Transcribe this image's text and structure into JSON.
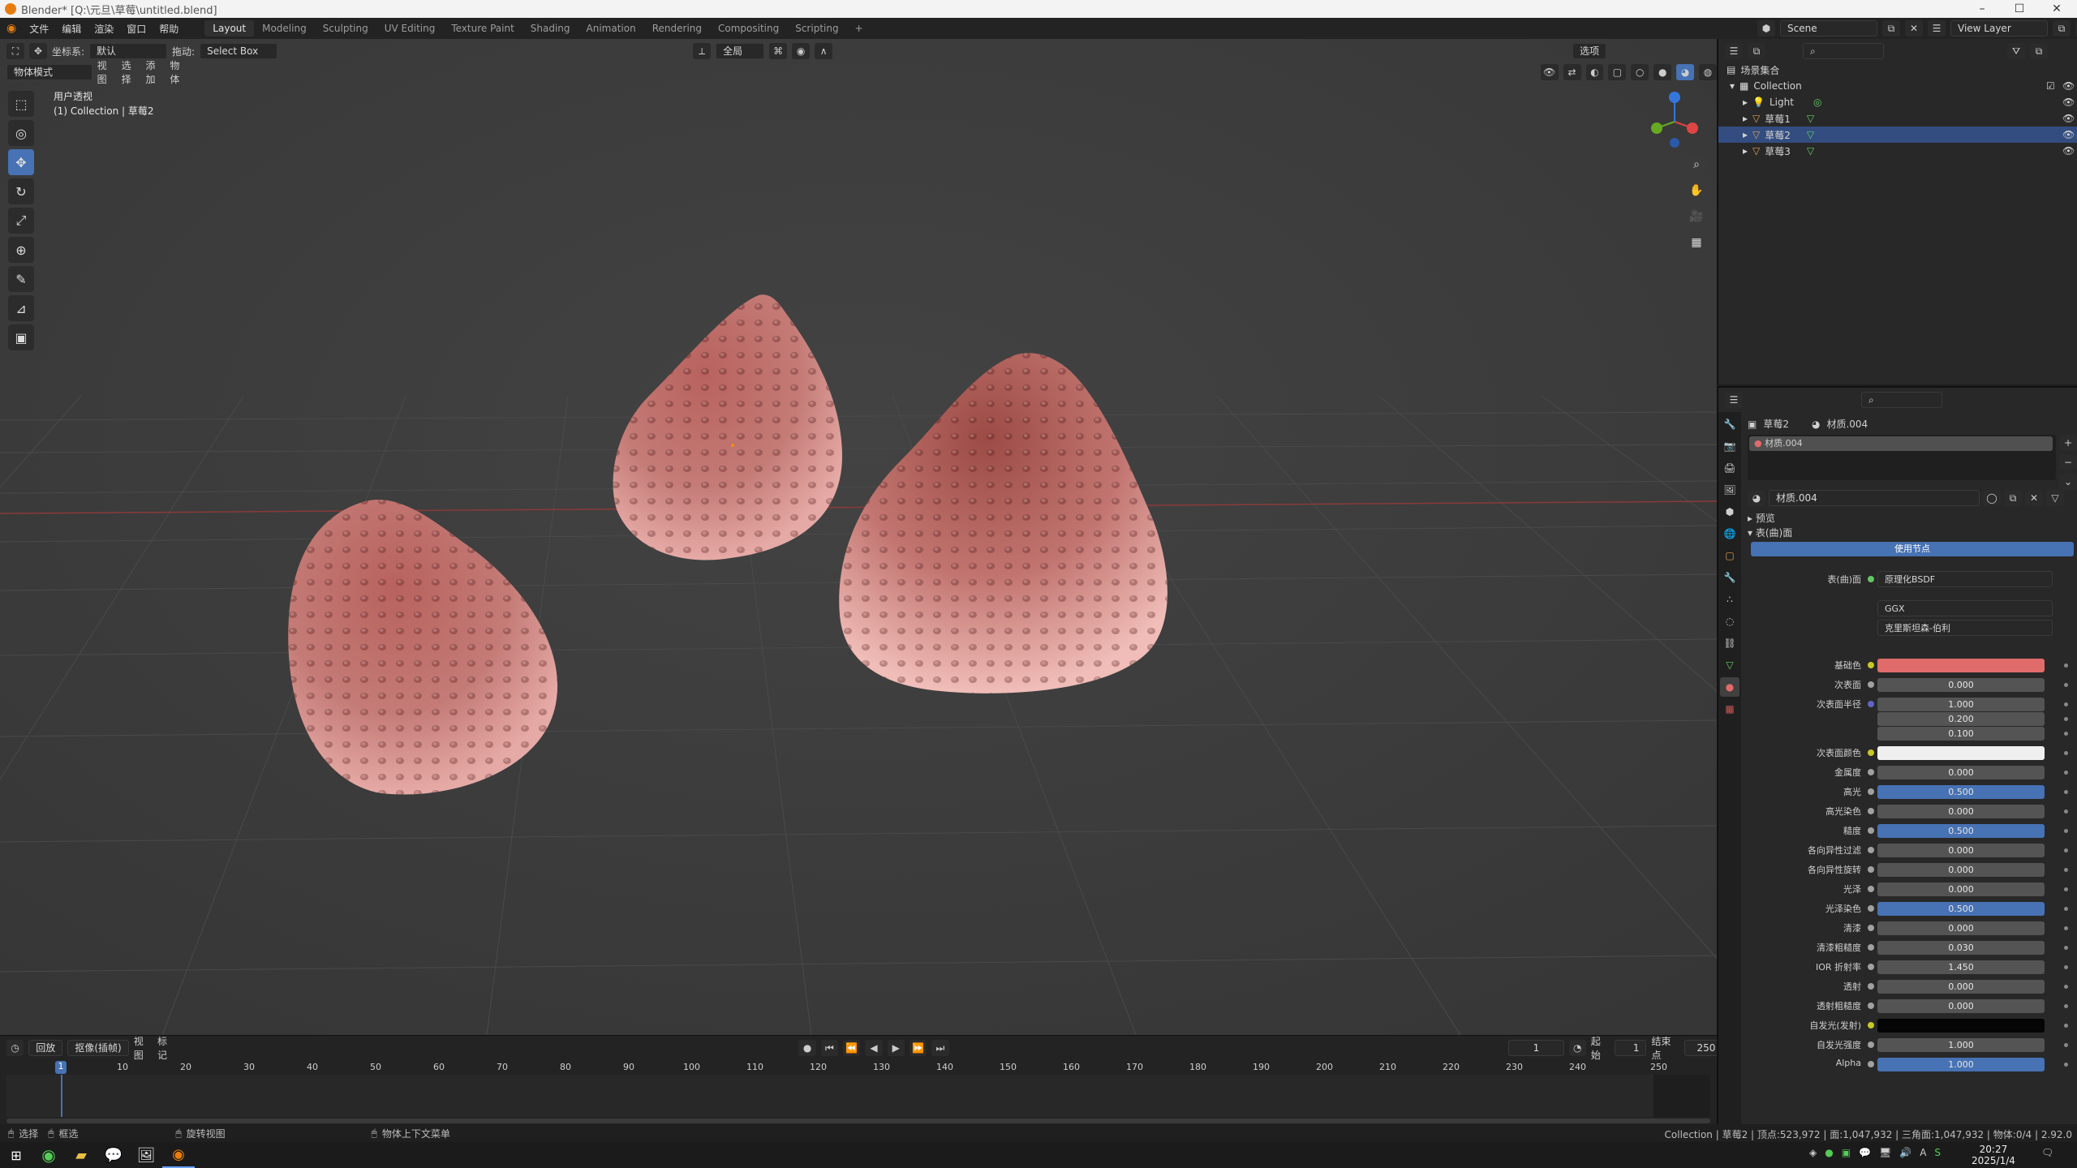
{
  "window": {
    "title": "Blender* [Q:\\元旦\\草莓\\untitled.blend]"
  },
  "menu": [
    "文件",
    "编辑",
    "渲染",
    "窗口",
    "帮助"
  ],
  "workspaces": [
    "Layout",
    "Modeling",
    "Sculpting",
    "UV Editing",
    "Texture Paint",
    "Shading",
    "Animation",
    "Rendering",
    "Compositing",
    "Scripting"
  ],
  "active_workspace": "Layout",
  "scene_selector": {
    "scene": "Scene",
    "view_layer": "View Layer"
  },
  "viewport_header": {
    "orientation_label": "坐标系:",
    "orientation_value": "默认",
    "drag_label": "拖动:",
    "drag_value": "Select Box",
    "pivot_value": "全局",
    "options_label": "选项",
    "mode": "物体模式",
    "view_menu": [
      "视图",
      "选择",
      "添加",
      "物体"
    ]
  },
  "viewport_info": {
    "line1": "用户透视",
    "line2": "(1) Collection | 草莓2"
  },
  "tools": [
    {
      "name": "select-box-icon",
      "glyph": "⬚"
    },
    {
      "name": "cursor-icon",
      "glyph": "◎"
    },
    {
      "name": "move-icon",
      "glyph": "✥"
    },
    {
      "name": "rotate-icon",
      "glyph": "↻"
    },
    {
      "name": "scale-icon",
      "glyph": "⤢"
    },
    {
      "name": "transform-icon",
      "glyph": "⊕"
    },
    {
      "name": "annotate-icon",
      "glyph": "✎"
    },
    {
      "name": "measure-icon",
      "glyph": "📐"
    },
    {
      "name": "add-cube-icon",
      "glyph": "▣"
    }
  ],
  "outliner": {
    "root": "场景集合",
    "collection": "Collection",
    "items": [
      "Light",
      "草莓1",
      "草莓2",
      "草莓3"
    ]
  },
  "properties": {
    "object_name": "草莓2",
    "material_name": "材质.004",
    "slot_name": "材质.004",
    "section_preview": "预览",
    "section_surface": "表(曲)面",
    "use_nodes": "使用节点",
    "surface_label": "表(曲)面",
    "surface_value": "原理化BSDF",
    "distribution": "GGX",
    "subsurface_method": "克里斯坦森-伯利",
    "rows": [
      {
        "label": "基础色",
        "value": "",
        "color": "#e06b6b",
        "sock": "#c7c729"
      },
      {
        "label": "次表面",
        "value": "0.000",
        "color": "#545454",
        "sock": "#a1a1a1"
      },
      {
        "label": "次表面半径",
        "value": "1.000",
        "color": "#545454",
        "sock": "#6363c7"
      },
      {
        "label": "",
        "value": "0.200",
        "color": "#545454",
        "sock": ""
      },
      {
        "label": "",
        "value": "0.100",
        "color": "#545454",
        "sock": ""
      },
      {
        "label": "次表面颜色",
        "value": "",
        "color": "#efefef",
        "sock": "#c7c729"
      },
      {
        "label": "金属度",
        "value": "0.000",
        "color": "#545454",
        "sock": "#a1a1a1"
      },
      {
        "label": "高光",
        "value": "0.500",
        "color": "#4772b3",
        "sock": "#a1a1a1"
      },
      {
        "label": "高光染色",
        "value": "0.000",
        "color": "#545454",
        "sock": "#a1a1a1"
      },
      {
        "label": "糙度",
        "value": "0.500",
        "color": "#4772b3",
        "sock": "#a1a1a1"
      },
      {
        "label": "各向异性过滤",
        "value": "0.000",
        "color": "#545454",
        "sock": "#a1a1a1"
      },
      {
        "label": "各向异性旋转",
        "value": "0.000",
        "color": "#545454",
        "sock": "#a1a1a1"
      },
      {
        "label": "光泽",
        "value": "0.000",
        "color": "#545454",
        "sock": "#a1a1a1"
      },
      {
        "label": "光泽染色",
        "value": "0.500",
        "color": "#4772b3",
        "sock": "#a1a1a1"
      },
      {
        "label": "清漆",
        "value": "0.000",
        "color": "#545454",
        "sock": "#a1a1a1"
      },
      {
        "label": "清漆粗糙度",
        "value": "0.030",
        "color": "#545454",
        "sock": "#a1a1a1"
      },
      {
        "label": "IOR 折射率",
        "value": "1.450",
        "color": "#545454",
        "sock": "#a1a1a1"
      },
      {
        "label": "透射",
        "value": "0.000",
        "color": "#545454",
        "sock": "#a1a1a1"
      },
      {
        "label": "透射粗糙度",
        "value": "0.000",
        "color": "#545454",
        "sock": "#a1a1a1"
      },
      {
        "label": "自发光(发射)",
        "value": "",
        "color": "#050505",
        "sock": "#c7c729"
      },
      {
        "label": "自发光强度",
        "value": "1.000",
        "color": "#545454",
        "sock": "#a1a1a1"
      },
      {
        "label": "Alpha",
        "value": "1.000",
        "color": "#4772b3",
        "sock": "#a1a1a1"
      }
    ]
  },
  "timeline": {
    "menu": [
      "回放",
      "抠像(插帧)",
      "视图",
      "标记"
    ],
    "current_frame": "1",
    "start_label": "起始",
    "start": "1",
    "end_label": "结束点",
    "end": "250",
    "ticks": [
      "1",
      "10",
      "20",
      "30",
      "40",
      "50",
      "60",
      "70",
      "80",
      "90",
      "100",
      "110",
      "120",
      "130",
      "140",
      "150",
      "160",
      "170",
      "180",
      "190",
      "200",
      "210",
      "220",
      "230",
      "240",
      "250"
    ]
  },
  "statusbar": {
    "select": "选择",
    "box_select": "框选",
    "rotate_view": "旋转视图",
    "context_menu": "物体上下文菜单",
    "stats": "Collection | 草莓2 | 顶点:523,972 | 面:1,047,932 | 三角面:1,047,932 | 物体:0/4 | 2.92.0"
  },
  "clock": {
    "time": "20:27",
    "date": "2025/1/4"
  }
}
